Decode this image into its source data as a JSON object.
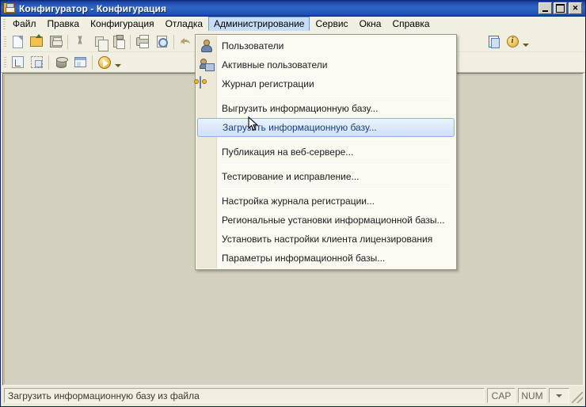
{
  "window": {
    "title": "Конфигуратор - Конфигурация",
    "icon": "app-config-icon",
    "controls": {
      "minimize": "_",
      "maximize": "□",
      "close": "✕"
    }
  },
  "menubar": {
    "items": [
      {
        "label": "Файл",
        "accel": "Ф",
        "name": "menu-file",
        "open": false
      },
      {
        "label": "Правка",
        "accel": "П",
        "name": "menu-edit",
        "open": false
      },
      {
        "label": "Конфигурация",
        "accel": "",
        "name": "menu-configuration",
        "open": false
      },
      {
        "label": "Отладка",
        "accel": "",
        "name": "menu-debug",
        "open": false
      },
      {
        "label": "Администрирование",
        "accel": "А",
        "name": "menu-administration",
        "open": true
      },
      {
        "label": "Сервис",
        "accel": "С",
        "name": "menu-service",
        "open": false
      },
      {
        "label": "Окна",
        "accel": "О",
        "name": "menu-windows",
        "open": false
      },
      {
        "label": "Справка",
        "accel": "",
        "name": "menu-help",
        "open": false
      }
    ]
  },
  "toolbar_row1": {
    "buttons": [
      {
        "name": "new-icon",
        "icon": "ic-new"
      },
      {
        "name": "open-icon",
        "icon": "ic-open"
      },
      {
        "name": "save-icon",
        "icon": "ic-save"
      },
      {
        "name": "cut-icon",
        "icon": "ic-cut"
      },
      {
        "name": "copy-icon",
        "icon": "ic-copy"
      },
      {
        "name": "paste-icon",
        "icon": "ic-paste"
      },
      {
        "name": "print-icon",
        "icon": "ic-print"
      },
      {
        "name": "print-preview-icon",
        "icon": "ic-preview"
      },
      {
        "name": "undo-icon",
        "icon": "ic-undo"
      },
      {
        "name": "redo-icon",
        "icon": "ic-redo"
      },
      {
        "name": "syntax-assistant-icon",
        "icon": "ic-doc-red"
      },
      {
        "name": "info-icon",
        "icon": "ic-info"
      }
    ]
  },
  "toolbar_row2": {
    "buttons": [
      {
        "name": "config-tree-icon",
        "icon": "ic-tree"
      },
      {
        "name": "config-compare-icon",
        "icon": "ic-tree2"
      },
      {
        "name": "database-icon",
        "icon": "ic-db"
      },
      {
        "name": "interface-icon",
        "icon": "ic-win"
      },
      {
        "name": "run-debug-icon",
        "icon": "ic-run"
      }
    ]
  },
  "dropdown": {
    "owner": "Администрирование",
    "items": [
      {
        "label": "Пользователи",
        "icon": "user-icon",
        "selected": false,
        "separator_after": false
      },
      {
        "label": "Активные пользователи",
        "icon": "active-users-icon",
        "selected": false,
        "separator_after": false
      },
      {
        "label": "Журнал регистрации",
        "icon": "registration-log-icon",
        "selected": false,
        "separator_after": true
      },
      {
        "label": "Выгрузить информационную базу...",
        "icon": "",
        "selected": false,
        "separator_after": false
      },
      {
        "label": "Загрузить информационную базу...",
        "icon": "",
        "selected": true,
        "separator_after": true
      },
      {
        "label": "Публикация на веб-сервере...",
        "icon": "",
        "selected": false,
        "separator_after": true
      },
      {
        "label": "Тестирование и исправление...",
        "icon": "",
        "selected": false,
        "separator_after": true
      },
      {
        "label": "Настройка журнала регистрации...",
        "icon": "",
        "selected": false,
        "separator_after": false
      },
      {
        "label": "Региональные установки информационной базы...",
        "icon": "",
        "selected": false,
        "separator_after": false
      },
      {
        "label": "Установить настройки клиента лицензирования",
        "icon": "",
        "selected": false,
        "separator_after": false
      },
      {
        "label": "Параметры информационной базы...",
        "icon": "",
        "selected": false,
        "separator_after": false
      }
    ]
  },
  "statusbar": {
    "message": "Загрузить информационную базу из файла",
    "indicators": [
      {
        "label": "CAP",
        "name": "caps-lock-indicator"
      },
      {
        "label": "NUM",
        "name": "num-lock-indicator"
      }
    ],
    "dropdown_arrow": "▾"
  },
  "colors": {
    "titlebar_start": "#0a246a",
    "titlebar_mid": "#2f66c4",
    "chrome": "#f0efe2",
    "client_area": "#d4d0c0",
    "menu_background": "#faf9f2",
    "selection_border": "#8db2e3",
    "selection_text": "#16417c",
    "menu_open_highlight": "#c6ddf7"
  }
}
